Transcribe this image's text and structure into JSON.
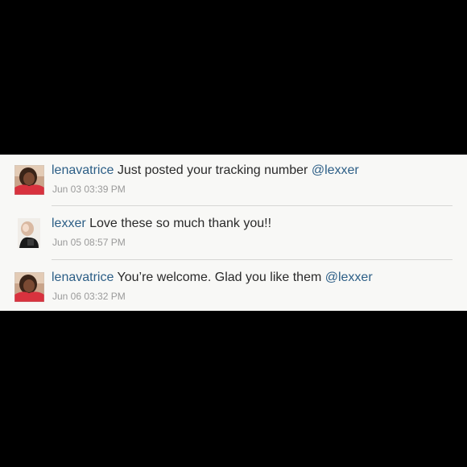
{
  "comments": [
    {
      "username": "lenavatrice",
      "text": " Just posted your tracking number ",
      "mention": "@lexxer",
      "timestamp": "Jun 03 03:39 PM"
    },
    {
      "username": "lexxer",
      "text": " Love these so much thank you!!",
      "mention": "",
      "timestamp": "Jun 05 08:57 PM"
    },
    {
      "username": "lenavatrice",
      "text": " You’re welcome. Glad you like them ",
      "mention": "@lexxer",
      "timestamp": "Jun 06 03:32 PM"
    }
  ],
  "colors": {
    "username": "#2c5e86",
    "text": "#2a2a2a",
    "timestamp": "#9a9a9a",
    "panel_background": "#f8f8f6",
    "frame_background": "#000000"
  }
}
